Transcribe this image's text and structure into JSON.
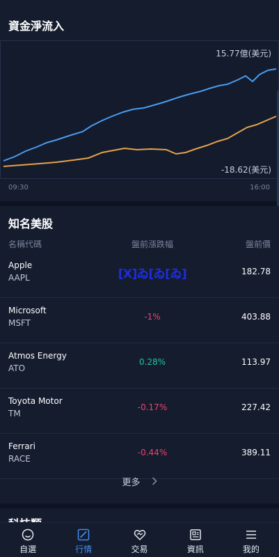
{
  "flow": {
    "title": "資金淨流入",
    "max_label": "15.77億(美元)",
    "min_label": "-18.62(美元)",
    "time_start": "09:30",
    "time_end": "16:00",
    "colors": {
      "blue_line": "#4a9cf0",
      "orange_line": "#e8a24a"
    }
  },
  "stocks": {
    "title": "知名美股",
    "columns": {
      "name": "名稱代碼",
      "change": "盤前漲跌幅",
      "price": "盤前價"
    },
    "rows": [
      {
        "name": "Apple",
        "code": "AAPL",
        "change": "",
        "overlay": "[X]ゐ[ゐ[ゐ]",
        "price": "182.78",
        "dir": "none"
      },
      {
        "name": "Microsoft",
        "code": "MSFT",
        "change": "-1%",
        "price": "403.88",
        "dir": "down"
      },
      {
        "name": "Atmos Energy",
        "code": "ATO",
        "change": "0.28%",
        "price": "113.97",
        "dir": "up"
      },
      {
        "name": "Toyota Motor",
        "code": "TM",
        "change": "-0.17%",
        "price": "227.42",
        "dir": "down"
      },
      {
        "name": "Ferrari",
        "code": "RACE",
        "change": "-0.44%",
        "price": "389.11",
        "dir": "down"
      }
    ],
    "more_label": "更多"
  },
  "next_section": {
    "title": "科技類"
  },
  "tabs": [
    {
      "label": "自選",
      "icon": "smile-icon"
    },
    {
      "label": "行情",
      "icon": "chart-icon",
      "active": true
    },
    {
      "label": "交易",
      "icon": "trade-icon"
    },
    {
      "label": "資訊",
      "icon": "news-icon"
    },
    {
      "label": "我的",
      "icon": "menu-icon"
    }
  ]
}
